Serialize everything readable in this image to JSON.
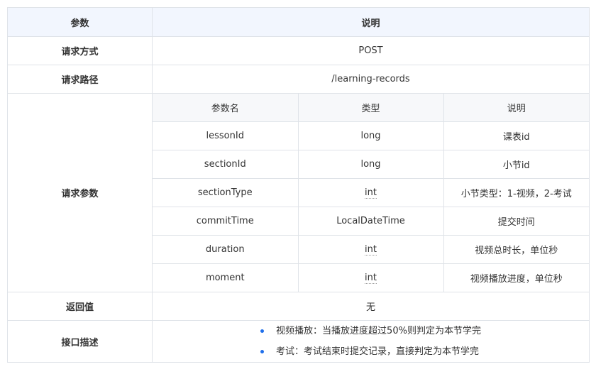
{
  "header": {
    "param_col": "参数",
    "desc_col": "说明"
  },
  "rows": {
    "method": {
      "label": "请求方式",
      "value": "POST"
    },
    "path": {
      "label": "请求路径",
      "value": "/learning-records"
    },
    "params": {
      "label": "请求参数",
      "columns": [
        "参数名",
        "类型",
        "说明"
      ],
      "items": [
        {
          "name": "lessonId",
          "type": "long",
          "desc": "课表id"
        },
        {
          "name": "sectionId",
          "type": "long",
          "desc": "小节id"
        },
        {
          "name": "sectionType",
          "type": "int",
          "desc": "小节类型：1-视频，2-考试"
        },
        {
          "name": "commitTime",
          "type": "LocalDateTime",
          "desc": "提交时间"
        },
        {
          "name": "duration",
          "type": "int",
          "desc": "视频总时长，单位秒"
        },
        {
          "name": "moment",
          "type": "int",
          "desc": "视频播放进度，单位秒"
        }
      ]
    },
    "return": {
      "label": "返回值",
      "value": "无"
    },
    "description": {
      "label": "接口描述",
      "bullets": [
        "视频播放：当播放进度超过50%则判定为本节学完",
        "考试：考试结束时提交记录，直接判定为本节学完"
      ]
    }
  },
  "colors": {
    "header_bg": "#f2f6fe",
    "sub_header_bg": "#f7f8fa",
    "border": "#dfe3e8",
    "bullet": "#1f6feb"
  }
}
